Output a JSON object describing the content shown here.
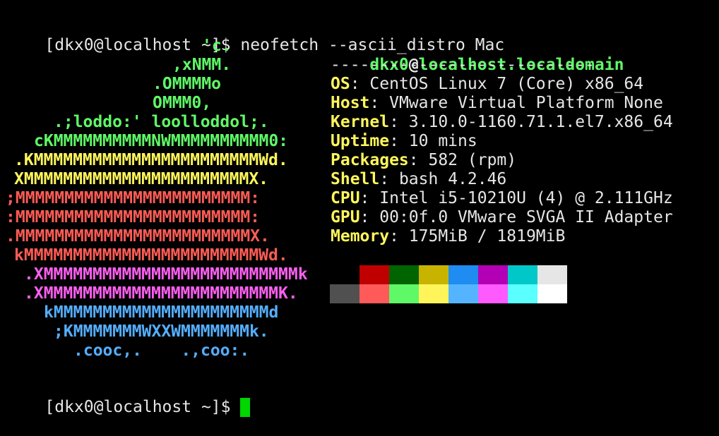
{
  "colors": {
    "background": "#000000",
    "foreground": "#e6e6e6",
    "green": "#5ff967",
    "yellow": "#fef65b",
    "red": "#fe5c55",
    "magenta": "#fd5ff1",
    "blue": "#55aefd",
    "cursor": "#00d600"
  },
  "terminal": {
    "command_prompt": "[dkx0@localhost ~]$ ",
    "command": "neofetch --ascii_distro Mac",
    "final_prompt": "[dkx0@localhost ~]$ "
  },
  "ascii_art": [
    {
      "text": "'c.",
      "color": "#5ff967"
    },
    {
      "text": ",xNMM.",
      "color": "#5ff967"
    },
    {
      "text": ".OMMMMo",
      "color": "#5ff967"
    },
    {
      "text": "OMMM0,",
      "color": "#5ff967"
    },
    {
      "text": ".;loddo:' loolloddol;.",
      "color": "#5ff967"
    },
    {
      "text": "cKMMMMMMMMMMNWMMMMMMMMMM0:",
      "color": "#5ff967"
    },
    {
      "text": ".KMMMMMMMMMMMMMMMMMMMMMMMWd.",
      "color": "#fef65b"
    },
    {
      "text": "XMMMMMMMMMMMMMMMMMMMMMMMX.",
      "color": "#fef65b"
    },
    {
      "text": ";MMMMMMMMMMMMMMMMMMMMMMMM:",
      "color": "#fe5c55"
    },
    {
      "text": ":MMMMMMMMMMMMMMMMMMMMMMMM:",
      "color": "#fe5c55"
    },
    {
      "text": ".MMMMMMMMMMMMMMMMMMMMMMMMX.",
      "color": "#fe5c55"
    },
    {
      "text": "kMMMMMMMMMMMMMMMMMMMMMMMMWd.",
      "color": "#fe5c55"
    },
    {
      "text": ".XMMMMMMMMMMMMMMMMMMMMMMMMMMk",
      "color": "#fd5ff1"
    },
    {
      "text": ".XMMMMMMMMMMMMMMMMMMMMMMMMK.",
      "color": "#fd5ff1"
    },
    {
      "text": "kMMMMMMMMMMMMMMMMMMMMMMd",
      "color": "#55aefd"
    },
    {
      "text": ";KMMMMMMMWXXWMMMMMMMk.",
      "color": "#55aefd"
    },
    {
      "text": ".cooc,.    .,coo:.",
      "color": "#55aefd"
    }
  ],
  "info": {
    "user": "dkx0",
    "at": "@",
    "host": "localhost.localdomain",
    "separator": "---------------------------",
    "items": [
      {
        "label": "OS",
        "value": "CentOS Linux 7 (Core) x86_64"
      },
      {
        "label": "Host",
        "value": "VMware Virtual Platform None"
      },
      {
        "label": "Kernel",
        "value": "3.10.0-1160.71.1.el7.x86_64"
      },
      {
        "label": "Uptime",
        "value": "10 mins"
      },
      {
        "label": "Packages",
        "value": "582 (rpm)"
      },
      {
        "label": "Shell",
        "value": "bash 4.2.46"
      },
      {
        "label": "CPU",
        "value": "Intel i5-10210U (4) @ 2.111GHz"
      },
      {
        "label": "GPU",
        "value": "00:0f.0 VMware SVGA II Adapter"
      },
      {
        "label": "Memory",
        "value": "175MiB / 1819MiB"
      }
    ],
    "label_suffix": ": "
  },
  "palette": {
    "normal": [
      "#000000",
      "#c00000",
      "#006400",
      "#c8b400",
      "#1e8cf0",
      "#b400b4",
      "#00c8c8",
      "#e6e6e6"
    ],
    "bright": [
      "#505050",
      "#ff5a5a",
      "#5ff967",
      "#fff55a",
      "#55b4ff",
      "#ff5aff",
      "#5affff",
      "#ffffff"
    ]
  }
}
